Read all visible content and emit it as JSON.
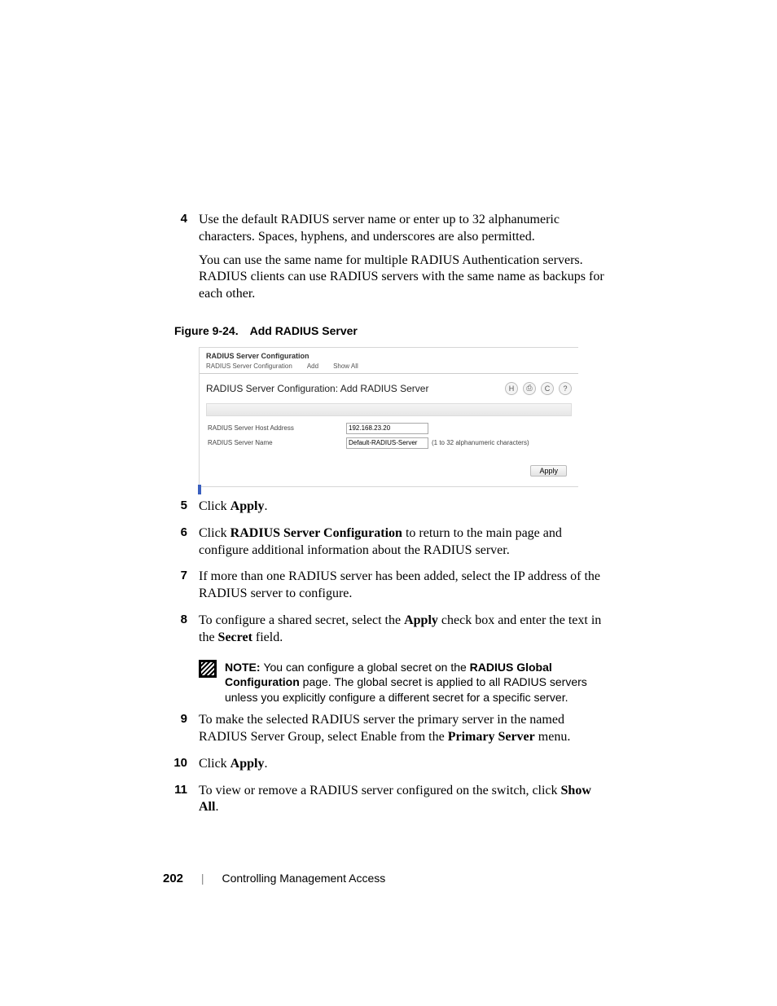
{
  "steps": {
    "s4": {
      "num": "4",
      "p1": "Use the default RADIUS server name or enter up to 32 alphanumeric characters. Spaces, hyphens, and underscores are also permitted.",
      "p2": "You can use the same name for multiple RADIUS Authentication servers. RADIUS clients can use RADIUS servers with the same name as backups for each other."
    },
    "s5": {
      "num": "5",
      "pre": "Click ",
      "b": "Apply",
      "post": "."
    },
    "s6": {
      "num": "6",
      "pre": "Click ",
      "b": "RADIUS Server Configuration",
      "post": " to return to the main page and configure additional information about the RADIUS server."
    },
    "s7": {
      "num": "7",
      "p": "If more than one RADIUS server has been added, select the IP address of the RADIUS server to configure."
    },
    "s8": {
      "num": "8",
      "pre": "To configure a shared secret, select the ",
      "b1": "Apply",
      "mid": " check box and enter the text in the ",
      "b2": "Secret",
      "post": " field."
    },
    "s9": {
      "num": "9",
      "pre": "To make the selected RADIUS server the primary server in the named RADIUS Server Group, select Enable from the ",
      "b": "Primary Server",
      "post": " menu."
    },
    "s10": {
      "num": "10",
      "pre": "Click ",
      "b": "Apply",
      "post": "."
    },
    "s11": {
      "num": "11",
      "pre": "To view or remove a RADIUS server configured on the switch, click ",
      "b": "Show All",
      "post": "."
    }
  },
  "figcap": {
    "num": "Figure 9-24.",
    "title": "Add RADIUS Server"
  },
  "shot": {
    "header": "RADIUS Server Configuration",
    "tabs": {
      "t1": "RADIUS Server Configuration",
      "t2": "Add",
      "t3": "Show All"
    },
    "title": "RADIUS Server Configuration: Add RADIUS Server",
    "icons": {
      "save": "H",
      "print": "⎙",
      "refresh": "C",
      "help": "?"
    },
    "row1": {
      "label": "RADIUS Server Host Address",
      "value": "192.168.23.20"
    },
    "row2": {
      "label": "RADIUS Server Name",
      "value": "Default-RADIUS-Server",
      "hint": "(1 to 32 alphanumeric characters)"
    },
    "apply": "Apply"
  },
  "note": {
    "lead": "NOTE: ",
    "pre": "You can configure a global secret on the ",
    "b": "RADIUS Global Configuration",
    "post": " page. The global secret is applied to all RADIUS servers unless you explicitly configure a different secret for a specific server."
  },
  "footer": {
    "page": "202",
    "chapter": "Controlling Management Access"
  }
}
